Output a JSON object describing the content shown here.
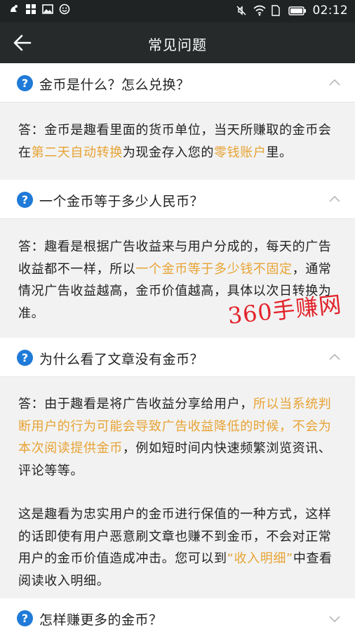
{
  "status_bar": {
    "time": "02:12",
    "icons": [
      "notification-icon",
      "apps-icon",
      "image-icon",
      "emoji-icon",
      "mute-icon",
      "wifi-icon",
      "sim-icon",
      "battery-icon"
    ]
  },
  "nav": {
    "title": "常见问题",
    "back_icon": "arrow-left-icon"
  },
  "faq": [
    {
      "question": "金币是什么？怎么兑换？",
      "expanded": true,
      "answer": [
        [
          {
            "t": "答：金币是趣看里面的货币单位，当天所赚取的金币会在"
          },
          {
            "t": "第二天自动转换",
            "hl": true
          },
          {
            "t": "为现金存入您的"
          },
          {
            "t": "零钱账户",
            "hl": true
          },
          {
            "t": "里。"
          }
        ]
      ]
    },
    {
      "question": "一个金币等于多少人民币？",
      "expanded": true,
      "answer": [
        [
          {
            "t": "答：趣看是根据广告收益来与用户分成的，每天的广告收益都不一样，所以"
          },
          {
            "t": "一个金币等于多少钱不固定",
            "hl": true
          },
          {
            "t": "，通常情况广告收益越高，金币价值越高，具体以次日转换为准。"
          }
        ]
      ]
    },
    {
      "question": "为什么看了文章没有金币？",
      "expanded": true,
      "answer": [
        [
          {
            "t": "答：由于趣看是将广告收益分享给用户，"
          },
          {
            "t": "所以当系统判断用户的行为可能会导致广告收益降低的时候，不会为本次阅读提供金币",
            "hl": true
          },
          {
            "t": "，例如短时间内快速频繁浏览资讯、评论等等。"
          }
        ],
        [
          {
            "t": "这是趣看为忠实用户的金币进行保值的一种方式，这样的话即使有用户恶意刷文章也赚不到金币，不会对正常用户的金币价值造成冲击。您可以到"
          },
          {
            "t": "“收入明细”",
            "hl": true
          },
          {
            "t": "中查看阅读收入明细。"
          }
        ]
      ]
    },
    {
      "question": "怎样赚更多的金币？",
      "expanded": false,
      "answer": []
    }
  ],
  "watermark": "360手赚网",
  "colors": {
    "status_bar": "#1f2324",
    "nav_bar": "#262a2b",
    "highlight": "#e7a334",
    "question_icon": "#1f7ad8",
    "watermark": "#e2232a"
  }
}
